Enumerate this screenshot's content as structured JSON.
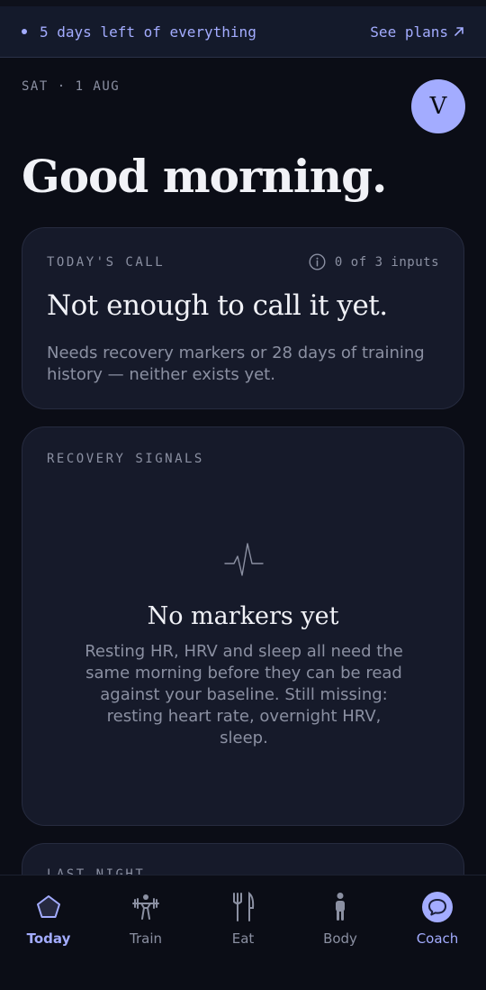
{
  "banner": {
    "message": "5 days left of everything",
    "link_label": "See plans"
  },
  "header": {
    "date": "SAT · 1 AUG",
    "avatar_initial": "V",
    "greeting": "Good morning."
  },
  "todays_call": {
    "eyebrow": "TODAY'S CALL",
    "inputs_status": "0 of 3 inputs",
    "title": "Not enough to call it yet.",
    "body": "Needs recovery markers or 28 days of training history — neither exists yet."
  },
  "recovery": {
    "eyebrow": "RECOVERY SIGNALS",
    "icon": "pulse-icon",
    "title": "No markers yet",
    "body": "Resting HR, HRV and sleep all need the same morning before they can be read against your baseline. Still missing: resting heart rate, overnight HRV, sleep."
  },
  "last_night": {
    "eyebrow": "LAST NIGHT"
  },
  "tabs": [
    {
      "label": "Today",
      "icon": "pentagon-icon",
      "active": true
    },
    {
      "label": "Train",
      "icon": "weightlifter-icon",
      "active": false
    },
    {
      "label": "Eat",
      "icon": "fork-knife-icon",
      "active": false
    },
    {
      "label": "Body",
      "icon": "person-icon",
      "active": false
    },
    {
      "label": "Coach",
      "icon": "chat-bubble-icon",
      "active": false
    }
  ],
  "colors": {
    "background": "#0b0d16",
    "card": "#161a2a",
    "accent": "#a3acff",
    "muted_text": "#8b90a2"
  }
}
